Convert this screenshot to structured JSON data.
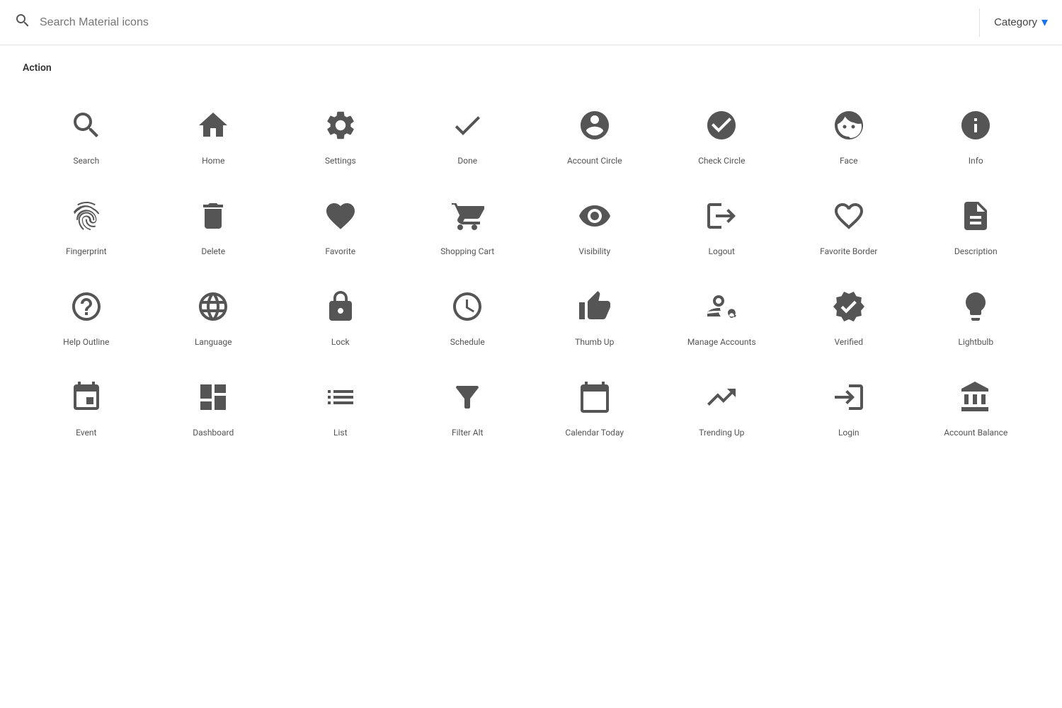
{
  "header": {
    "search_placeholder": "Search Material icons",
    "category_label": "Category"
  },
  "section": {
    "title": "Action"
  },
  "icons": [
    {
      "name": "Search",
      "id": "search"
    },
    {
      "name": "Home",
      "id": "home"
    },
    {
      "name": "Settings",
      "id": "settings"
    },
    {
      "name": "Done",
      "id": "done"
    },
    {
      "name": "Account Circle",
      "id": "account_circle"
    },
    {
      "name": "Check Circle",
      "id": "check_circle"
    },
    {
      "name": "Face",
      "id": "face"
    },
    {
      "name": "Info",
      "id": "info"
    },
    {
      "name": "Fingerprint",
      "id": "fingerprint"
    },
    {
      "name": "Delete",
      "id": "delete"
    },
    {
      "name": "Favorite",
      "id": "favorite"
    },
    {
      "name": "Shopping Cart",
      "id": "shopping_cart"
    },
    {
      "name": "Visibility",
      "id": "visibility"
    },
    {
      "name": "Logout",
      "id": "logout"
    },
    {
      "name": "Favorite Border",
      "id": "favorite_border"
    },
    {
      "name": "Description",
      "id": "description"
    },
    {
      "name": "Help Outline",
      "id": "help_outline"
    },
    {
      "name": "Language",
      "id": "language"
    },
    {
      "name": "Lock",
      "id": "lock"
    },
    {
      "name": "Schedule",
      "id": "schedule"
    },
    {
      "name": "Thumb Up",
      "id": "thumb_up"
    },
    {
      "name": "Manage Accounts",
      "id": "manage_accounts"
    },
    {
      "name": "Verified",
      "id": "verified"
    },
    {
      "name": "Lightbulb",
      "id": "lightbulb"
    },
    {
      "name": "Event",
      "id": "event"
    },
    {
      "name": "Dashboard",
      "id": "dashboard"
    },
    {
      "name": "List",
      "id": "list"
    },
    {
      "name": "Filter Alt",
      "id": "filter_alt"
    },
    {
      "name": "Calendar Today",
      "id": "calendar_today"
    },
    {
      "name": "Trending Up",
      "id": "trending_up"
    },
    {
      "name": "Login",
      "id": "login"
    },
    {
      "name": "Account Balance",
      "id": "account_balance"
    }
  ]
}
